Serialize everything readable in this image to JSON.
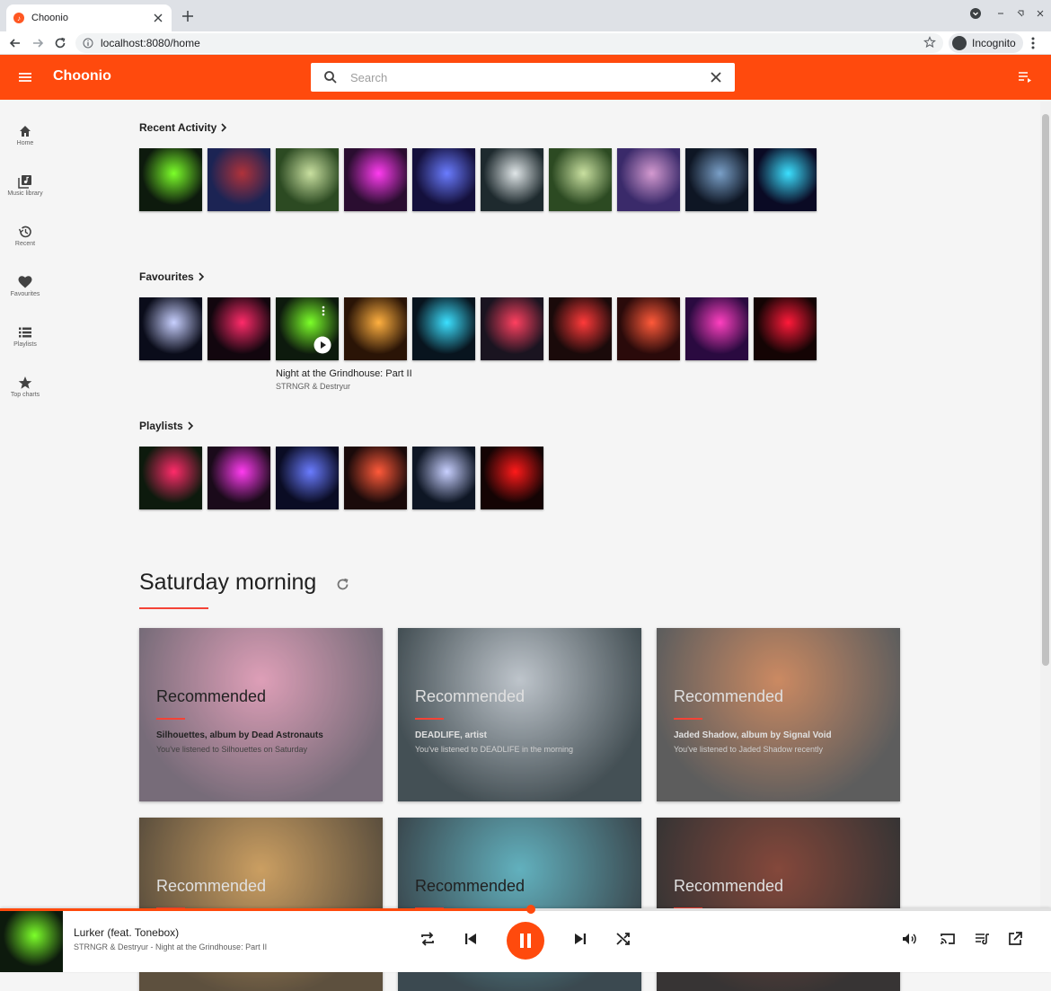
{
  "browser": {
    "tab_title": "Choonio",
    "tab_favicon_glyph": "♪",
    "url": "localhost:8080/home",
    "incognito_label": "Incognito"
  },
  "header": {
    "brand": "Choonio",
    "search_placeholder": "Search",
    "accent_color": "#ff4a0d"
  },
  "sidebar": {
    "items": [
      {
        "label": "Home",
        "icon": "home-icon"
      },
      {
        "label": "Music library",
        "icon": "library-icon"
      },
      {
        "label": "Recent",
        "icon": "history-icon"
      },
      {
        "label": "Favourites",
        "icon": "heart-icon"
      },
      {
        "label": "Playlists",
        "icon": "list-icon"
      },
      {
        "label": "Top charts",
        "icon": "star-icon"
      }
    ]
  },
  "recent_activity": {
    "title": "Recent Activity",
    "covers": [
      {
        "colors": [
          "#0d1a0d",
          "#7cff2a"
        ]
      },
      {
        "colors": [
          "#1c2454",
          "#b0323a"
        ]
      },
      {
        "colors": [
          "#2c4a22",
          "#c9e0a0"
        ]
      },
      {
        "colors": [
          "#2a0d30",
          "#ff3cf0"
        ]
      },
      {
        "colors": [
          "#14103c",
          "#6a7cff"
        ]
      },
      {
        "colors": [
          "#1e2a2e",
          "#e0e6e8"
        ]
      },
      {
        "colors": [
          "#2c4a22",
          "#c9e0a0"
        ]
      },
      {
        "colors": [
          "#3a2a6a",
          "#d49ad0"
        ]
      },
      {
        "colors": [
          "#0e1624",
          "#7aa0c8"
        ]
      },
      {
        "colors": [
          "#0a0a24",
          "#3ce0ff"
        ]
      }
    ]
  },
  "favourites": {
    "title": "Favourites",
    "covers": [
      {
        "colors": [
          "#0a0c1a",
          "#c8d0ff"
        ]
      },
      {
        "colors": [
          "#12060e",
          "#ff2b6a"
        ]
      },
      {
        "colors": [
          "#0d1a0d",
          "#7cff2a"
        ]
      },
      {
        "colors": [
          "#2a1406",
          "#ffb040"
        ]
      },
      {
        "colors": [
          "#08141e",
          "#3ce0ff"
        ]
      },
      {
        "colors": [
          "#1a1420",
          "#ff4060"
        ]
      },
      {
        "colors": [
          "#1a0a0a",
          "#ff3a3a"
        ]
      },
      {
        "colors": [
          "#2a0a0a",
          "#ff5a3a"
        ]
      },
      {
        "colors": [
          "#2a0a40",
          "#ff40c0"
        ]
      },
      {
        "colors": [
          "#140404",
          "#ff1a3a"
        ]
      }
    ],
    "hovered_index": 2,
    "hover_title": "Night at the Grindhouse: Part II",
    "hover_subtitle": "STRNGR & Destryur"
  },
  "playlists": {
    "title": "Playlists",
    "covers": [
      {
        "colors": [
          "#0d1a0d",
          "#ff2b6a"
        ]
      },
      {
        "colors": [
          "#1a0a1a",
          "#ff3cf0"
        ]
      },
      {
        "colors": [
          "#0a0c24",
          "#6a7cff"
        ]
      },
      {
        "colors": [
          "#1a0a0a",
          "#ff5a3a"
        ]
      },
      {
        "colors": [
          "#0e1624",
          "#c8d0ff"
        ]
      },
      {
        "colors": [
          "#140404",
          "#ff1a1a"
        ]
      }
    ]
  },
  "saturday": {
    "title": "Saturday morning",
    "cards": [
      {
        "heading": "Recommended",
        "title": "Silhouettes, album by Dead Astronauts",
        "subtitle": "You've listened to Silhouettes on Saturday",
        "colors": [
          "#5a4c5c",
          "#d78aa8"
        ],
        "light": false
      },
      {
        "heading": "Recommended",
        "title": "DEADLIFE, artist",
        "subtitle": "You've listened to DEADLIFE in the morning",
        "colors": [
          "#1c2a30",
          "#b0b8c0"
        ],
        "light": true
      },
      {
        "heading": "Recommended",
        "title": "Jaded Shadow, album by Signal Void",
        "subtitle": "You've listened to Jaded Shadow recently",
        "colors": [
          "#3a3a3a",
          "#c07040"
        ],
        "light": true
      },
      {
        "heading": "Recommended",
        "title": "",
        "subtitle": "",
        "colors": [
          "#3a2a14",
          "#c08a40"
        ],
        "light": true
      },
      {
        "heading": "Recommended",
        "title": "",
        "subtitle": "",
        "colors": [
          "#10222a",
          "#40a0b0"
        ],
        "light": false
      },
      {
        "heading": "Recommended",
        "title": "",
        "subtitle": "",
        "colors": [
          "#0c0808",
          "#6a2010"
        ],
        "light": true
      }
    ]
  },
  "player": {
    "track_title": "Lurker (feat. Tonebox)",
    "track_subtitle": "STRNGR & Destryur - Night at the Grindhouse: Part II",
    "progress": 0.505,
    "cover_colors": [
      "#0d1a0d",
      "#7cff2a"
    ]
  }
}
